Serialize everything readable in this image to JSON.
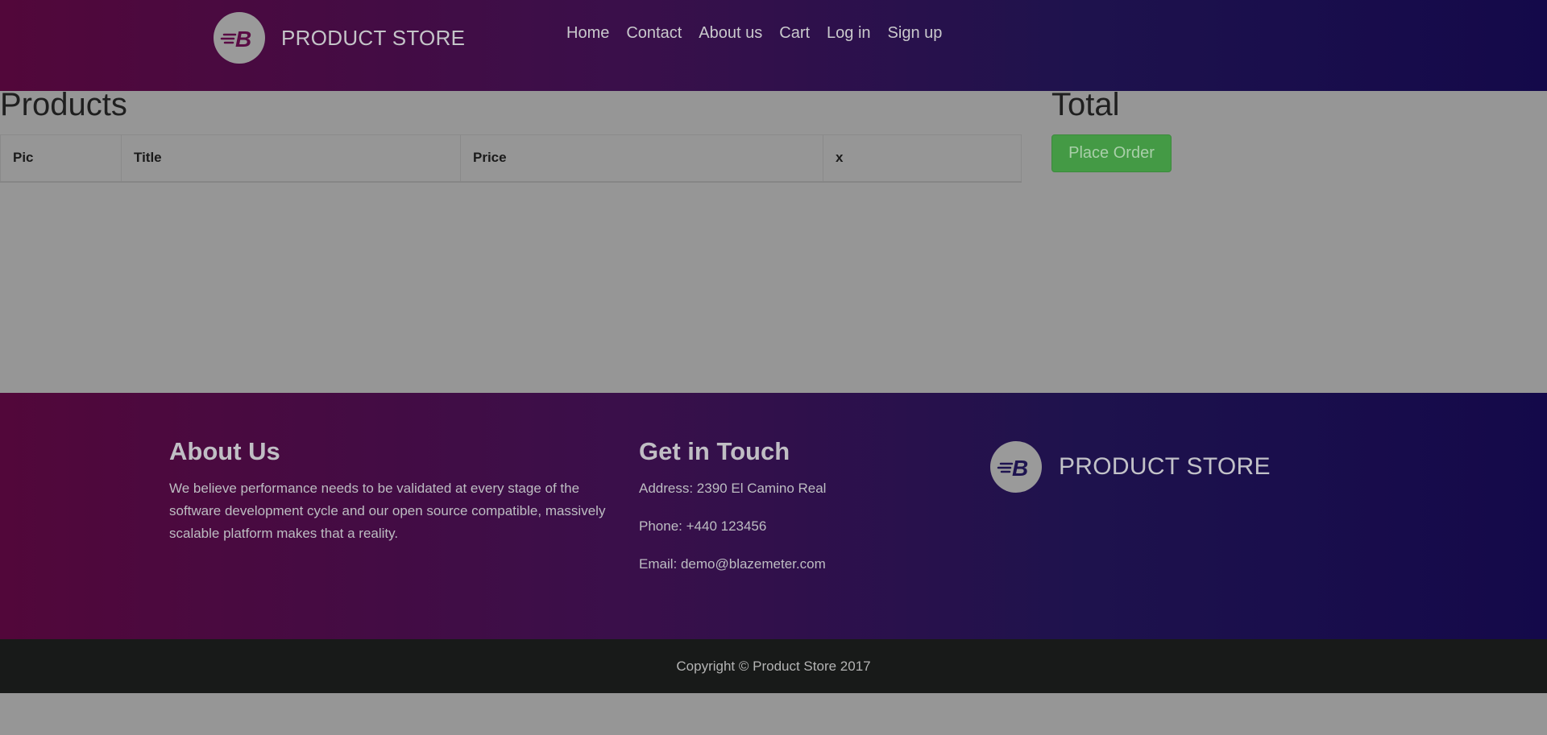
{
  "navbar": {
    "brand": "PRODUCT STORE",
    "logo_icon": "blazemeter-logo-icon",
    "links": [
      "Home",
      "Contact",
      "About us",
      "Cart",
      "Log in",
      "Sign up"
    ]
  },
  "cart": {
    "products_heading": "Products",
    "columns": [
      "Pic",
      "Title",
      "Price",
      "x"
    ],
    "rows": [],
    "total_heading": "Total",
    "place_order_label": "Place Order"
  },
  "footer": {
    "about": {
      "heading": "About Us",
      "text": "We believe performance needs to be validated at every stage of the software development cycle and our open source compatible, massively scalable platform makes that a reality."
    },
    "contact": {
      "heading": "Get in Touch",
      "address": "Address: 2390 El Camino Real",
      "phone": "Phone: +440 123456",
      "email": "Email: demo@blazemeter.com"
    },
    "brand": "PRODUCT STORE",
    "copyright": "Copyright © Product Store 2017"
  },
  "colors": {
    "accent_primary": "#52073a",
    "accent_secondary": "#14094a",
    "success_button": "#449a45",
    "overlay_background": "#969696"
  }
}
